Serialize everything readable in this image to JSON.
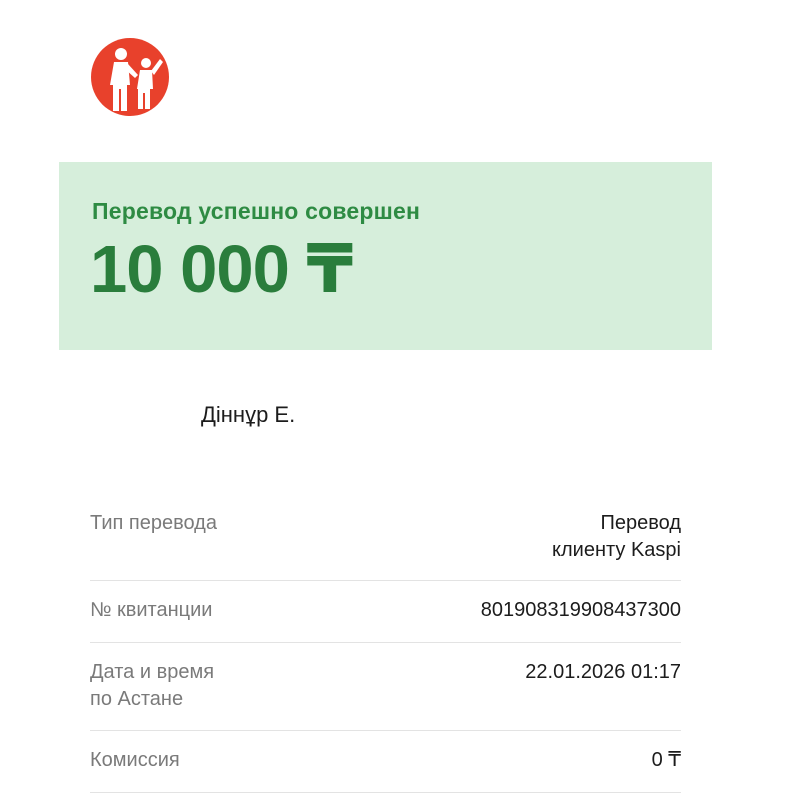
{
  "app": {
    "logo_icon": "kaspi-logo-icon",
    "logo_color": "#e8412c"
  },
  "status": {
    "message": "Перевод успешно совершен",
    "amount": "10 000 ₸",
    "panel_color": "#d6eedb",
    "text_color": "#2e8b43"
  },
  "recipient": {
    "name": "Діннұр Е."
  },
  "details": [
    {
      "label": "Тип перевода",
      "value": "Перевод\nклиенту Kaspi"
    },
    {
      "label": "№ квитанции",
      "value": "801908319908437300"
    },
    {
      "label": "Дата и время\nпо Астане",
      "value": "22.01.2026 01:17"
    },
    {
      "label": "Комиссия",
      "value": "0 ₸"
    }
  ]
}
